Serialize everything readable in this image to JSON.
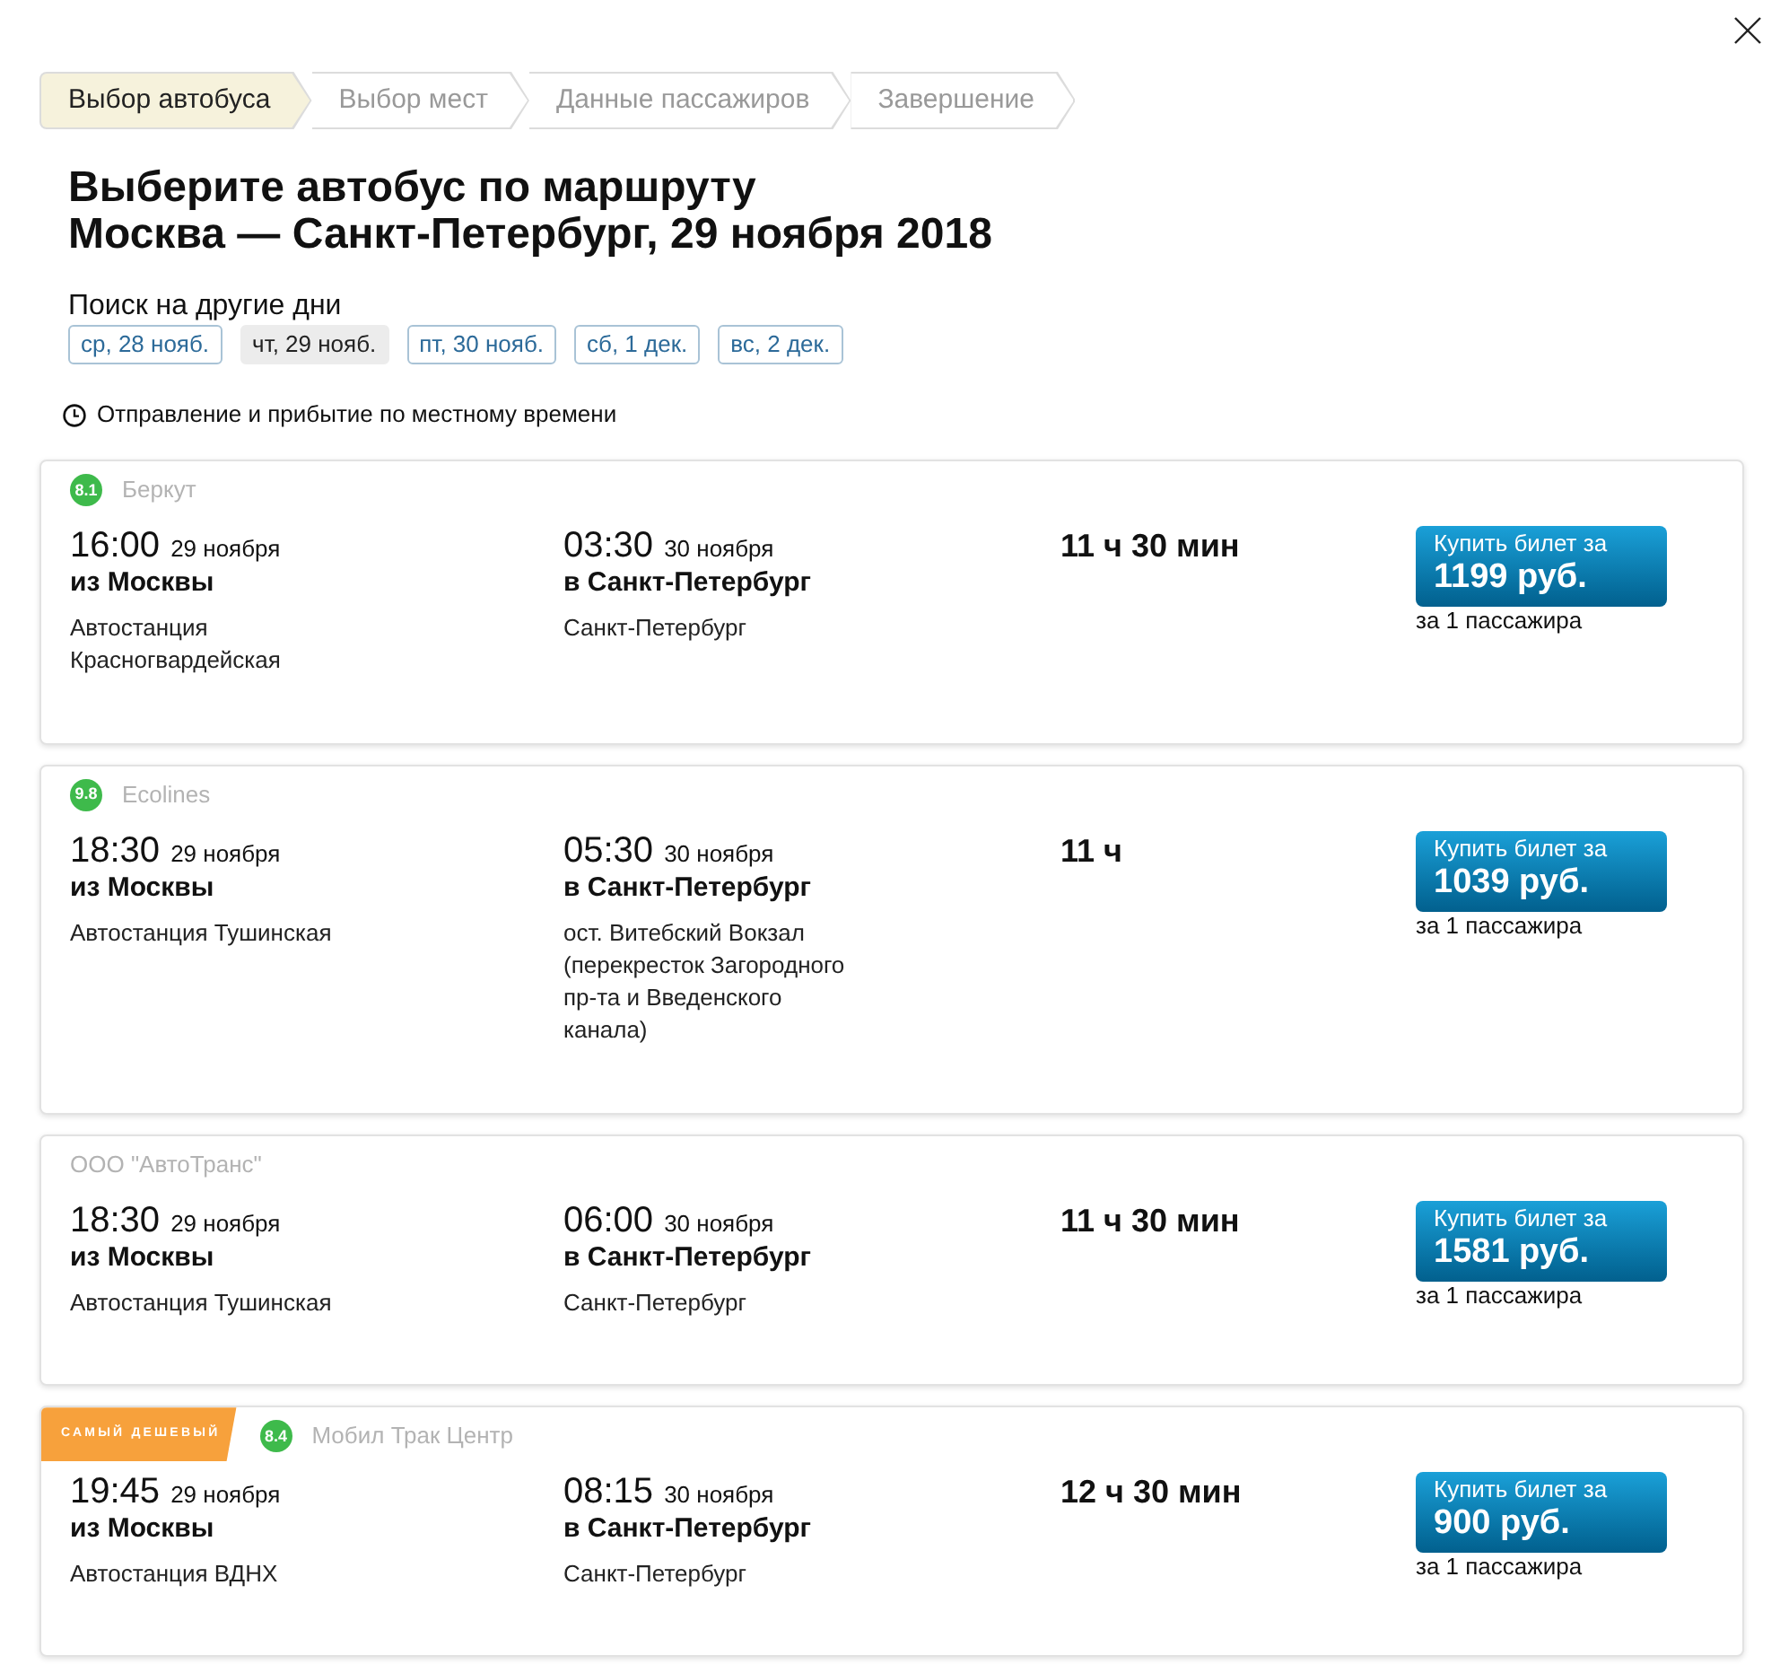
{
  "steps": [
    {
      "label": "Выбор автобуса",
      "selected": true
    },
    {
      "label": "Выбор мест",
      "selected": false
    },
    {
      "label": "Данные пассажиров",
      "selected": false
    },
    {
      "label": "Завершение",
      "selected": false
    }
  ],
  "heading": [
    "Выберите автобус по маршруту",
    "Москва — Санкт-Петербург, 29 ноября 2018"
  ],
  "other_days": {
    "label": "Поиск на другие дни",
    "days": [
      {
        "label": "ср, 28 нояб.",
        "selected": false
      },
      {
        "label": "чт, 29 нояб.",
        "selected": true
      },
      {
        "label": "пт, 30 нояб.",
        "selected": false
      },
      {
        "label": "сб, 1 дек.",
        "selected": false
      },
      {
        "label": "вс, 2 дек.",
        "selected": false
      }
    ]
  },
  "timezone_note": "Отправление и прибытие по местному времени",
  "trips": [
    {
      "rating": "8.1",
      "carrier": "Беркут",
      "departure": {
        "time": "16:00",
        "date": "29 ноября",
        "city": "из Москвы",
        "station": "Автостанция Красногвардейская"
      },
      "arrival": {
        "time": "03:30",
        "date": "30 ноября",
        "city": "в Санкт-Петербург",
        "station": "Санкт-Петербург"
      },
      "duration": "11 ч 30 мин",
      "buy_button": {
        "caption": "Купить билет за",
        "price": "1199 руб."
      },
      "price_note": "за 1 пассажира"
    },
    {
      "rating": "9.8",
      "carrier": "Ecolines",
      "departure": {
        "time": "18:30",
        "date": "29 ноября",
        "city": "из Москвы",
        "station": "Автостанция Тушинская"
      },
      "arrival": {
        "time": "05:30",
        "date": "30 ноября",
        "city": "в Санкт-Петербург",
        "station": "ост. Витебский Вокзал (перекресток Загородного пр-та и Введенского канала)"
      },
      "duration": "11 ч",
      "buy_button": {
        "caption": "Купить билет за",
        "price": "1039 руб."
      },
      "price_note": "за 1 пассажира"
    },
    {
      "carrier": "ООО \"АвтоТранс\"",
      "departure": {
        "time": "18:30",
        "date": "29 ноября",
        "city": "из Москвы",
        "station": "Автостанция Тушинская"
      },
      "arrival": {
        "time": "06:00",
        "date": "30 ноября",
        "city": "в Санкт-Петербург",
        "station": "Санкт-Петербург"
      },
      "duration": "11 ч 30 мин",
      "buy_button": {
        "caption": "Купить билет за",
        "price": "1581 руб."
      },
      "price_note": "за 1 пассажира"
    },
    {
      "label": "САМЫЙ ДЕШЕВЫЙ",
      "rating": "8.4",
      "carrier": "Мобил Трак Центр",
      "departure": {
        "time": "19:45",
        "date": "29 ноября",
        "city": "из Москвы",
        "station": "Автостанция ВДНХ"
      },
      "arrival": {
        "time": "08:15",
        "date": "30 ноября",
        "city": "в Санкт-Петербург",
        "station": "Санкт-Петербург"
      },
      "duration": "12 ч 30 мин",
      "buy_button": {
        "caption": "Купить билет за",
        "price": "900 руб."
      },
      "price_note": "за 1 пассажира"
    }
  ]
}
